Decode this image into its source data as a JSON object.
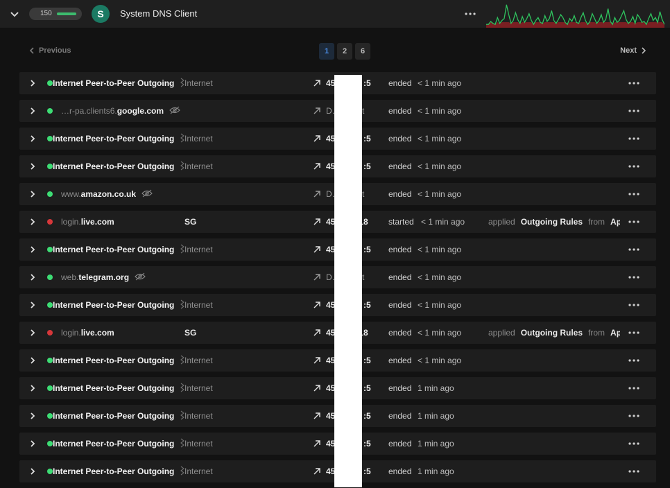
{
  "header": {
    "title": "System DNS Client",
    "avatar_letter": "S",
    "connection_count": "150",
    "accent": "#3dbb6e",
    "sparkline": [
      2,
      2,
      5,
      3,
      2,
      9,
      3,
      6,
      8,
      22,
      12,
      3,
      6,
      14,
      7,
      3,
      10,
      4,
      8,
      13,
      6,
      2,
      6,
      9,
      4,
      3,
      11,
      5,
      8,
      16,
      6,
      3,
      7,
      12,
      9,
      4,
      2,
      8,
      5,
      11,
      4,
      3,
      9,
      14,
      6,
      2,
      5,
      13,
      8,
      3,
      6,
      12,
      4,
      7,
      18,
      5,
      2,
      9,
      4,
      6,
      11,
      16,
      7,
      3,
      5,
      10,
      3,
      12,
      9,
      4,
      5,
      2,
      8,
      13,
      6,
      9,
      4,
      15,
      7,
      2
    ]
  },
  "pagination": {
    "previous": "Previous",
    "next": "Next",
    "pages": [
      "1",
      "2",
      "6"
    ],
    "current": "1"
  },
  "connections": [
    {
      "host_sub": "",
      "host_name": "Internet Peer-to-Peer Outgoing",
      "kind": "p2p",
      "network": "Internet",
      "address": "45……76 :5",
      "state": "ended",
      "time": "< 1 min ago",
      "status": "ok"
    },
    {
      "host_sub": "…r-pa.clients6.",
      "host_name": "google.com",
      "kind": "dns",
      "network": "",
      "address": "D……uest",
      "state": "ended",
      "time": "< 1 min ago",
      "status": "ok"
    },
    {
      "host_sub": "",
      "host_name": "Internet Peer-to-Peer Outgoing",
      "kind": "p2p",
      "network": "Internet",
      "address": "45……76 :5",
      "state": "ended",
      "time": "< 1 min ago",
      "status": "ok"
    },
    {
      "host_sub": "",
      "host_name": "Internet Peer-to-Peer Outgoing",
      "kind": "p2p",
      "network": "Internet",
      "address": "45……76 :5",
      "state": "ended",
      "time": "< 1 min ago",
      "status": "ok"
    },
    {
      "host_sub": "www.",
      "host_name": "amazon.co.uk",
      "kind": "dns",
      "network": "",
      "address": "D……uest",
      "state": "ended",
      "time": "< 1 min ago",
      "status": "ok"
    },
    {
      "host_sub": "login.",
      "host_name": "live.com",
      "kind": "blocked",
      "network": "SG",
      "address": "45…….218",
      "state": "started",
      "time": "< 1 min ago",
      "status": "blocked",
      "applied": "applied",
      "rule": "Outgoing Rules",
      "from": "from",
      "source": "Ap"
    },
    {
      "host_sub": "",
      "host_name": "Internet Peer-to-Peer Outgoing",
      "kind": "p2p",
      "network": "Internet",
      "address": "45……76 :5",
      "state": "ended",
      "time": "< 1 min ago",
      "status": "ok"
    },
    {
      "host_sub": "web.",
      "host_name": "telegram.org",
      "kind": "dns",
      "network": "",
      "address": "D……uest",
      "state": "ended",
      "time": "< 1 min ago",
      "status": "ok"
    },
    {
      "host_sub": "",
      "host_name": "Internet Peer-to-Peer Outgoing",
      "kind": "p2p",
      "network": "Internet",
      "address": "45……76 :5",
      "state": "ended",
      "time": "< 1 min ago",
      "status": "ok"
    },
    {
      "host_sub": "login.",
      "host_name": "live.com",
      "kind": "blocked",
      "network": "SG",
      "address": "45…….218",
      "state": "ended",
      "time": "< 1 min ago",
      "status": "blocked",
      "applied": "applied",
      "rule": "Outgoing Rules",
      "from": "from",
      "source": "Ap"
    },
    {
      "host_sub": "",
      "host_name": "Internet Peer-to-Peer Outgoing",
      "kind": "p2p",
      "network": "Internet",
      "address": "45……76 :5",
      "state": "ended",
      "time": "< 1 min ago",
      "status": "ok"
    },
    {
      "host_sub": "",
      "host_name": "Internet Peer-to-Peer Outgoing",
      "kind": "p2p",
      "network": "Internet",
      "address": "45……76 :5",
      "state": "ended",
      "time": "1 min ago",
      "status": "ok"
    },
    {
      "host_sub": "",
      "host_name": "Internet Peer-to-Peer Outgoing",
      "kind": "p2p",
      "network": "Internet",
      "address": "45……76 :5",
      "state": "ended",
      "time": "1 min ago",
      "status": "ok"
    },
    {
      "host_sub": "",
      "host_name": "Internet Peer-to-Peer Outgoing",
      "kind": "p2p",
      "network": "Internet",
      "address": "45……76 :5",
      "state": "ended",
      "time": "1 min ago",
      "status": "ok"
    },
    {
      "host_sub": "",
      "host_name": "Internet Peer-to-Peer Outgoing",
      "kind": "p2p",
      "network": "Internet",
      "address": "45……76 :5",
      "state": "ended",
      "time": "1 min ago",
      "status": "ok"
    }
  ],
  "colors": {
    "ok": "#3ddc74",
    "blocked": "#d6373a",
    "spark_line": "#2fc25e",
    "spark_fill": "#7a1f22"
  },
  "icons": {
    "expand": "chevron-right-icon",
    "p2p": "p2p-icon",
    "dns_hidden": "eye-off-icon",
    "direction": "arrow-up-right-icon",
    "more": "more-icon"
  }
}
